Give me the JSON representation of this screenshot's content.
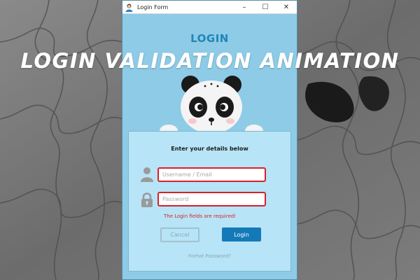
{
  "banner": {
    "text": "LOGIN VALIDATION ANIMATION"
  },
  "window": {
    "title": "Login Form",
    "controls": {
      "minimize": "–",
      "maximize": "☐",
      "close": "✕"
    }
  },
  "header": {
    "title": "LOGIN"
  },
  "form": {
    "heading": "Enter your details below",
    "username": {
      "value": "",
      "placeholder": "Username / Email"
    },
    "password": {
      "value": "",
      "placeholder": "Password"
    },
    "error": "The Login fields are required!",
    "cancel_label": "Cancel",
    "login_label": "Login",
    "forgot_label": "Forhot Password?"
  },
  "icons": {
    "user": "user-icon",
    "lock": "lock-icon",
    "mascot": "panda-mascot"
  },
  "colors": {
    "window_bg": "#8ecbe6",
    "card_bg": "#b7e4f7",
    "accent": "#1479b8",
    "heading": "#1f86b8",
    "error": "#d8202a"
  }
}
